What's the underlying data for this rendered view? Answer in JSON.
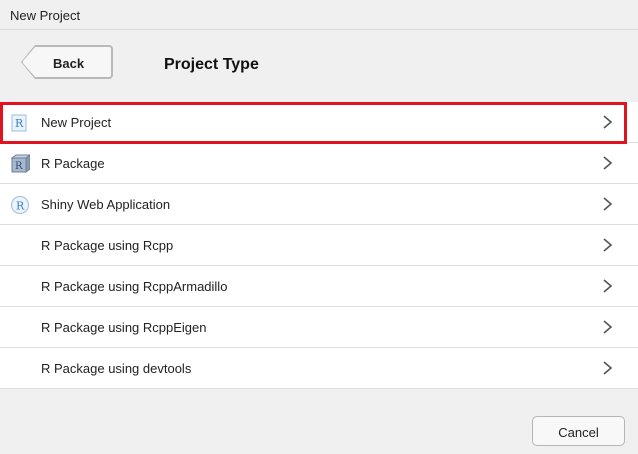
{
  "window": {
    "title": "New Project"
  },
  "header": {
    "back_label": "Back",
    "title": "Project Type"
  },
  "project_types": [
    {
      "label": "New Project",
      "icon": "r-project-icon",
      "selected": true
    },
    {
      "label": "R Package",
      "icon": "r-package-icon"
    },
    {
      "label": "Shiny Web Application",
      "icon": "shiny-icon"
    },
    {
      "label": "R Package using Rcpp",
      "icon": ""
    },
    {
      "label": "R Package using RcppArmadillo",
      "icon": ""
    },
    {
      "label": "R Package using RcppEigen",
      "icon": ""
    },
    {
      "label": "R Package using devtools",
      "icon": ""
    }
  ],
  "footer": {
    "cancel_label": "Cancel"
  },
  "colors": {
    "highlight": "#e0141e",
    "r_blue": "#3b82c4"
  }
}
